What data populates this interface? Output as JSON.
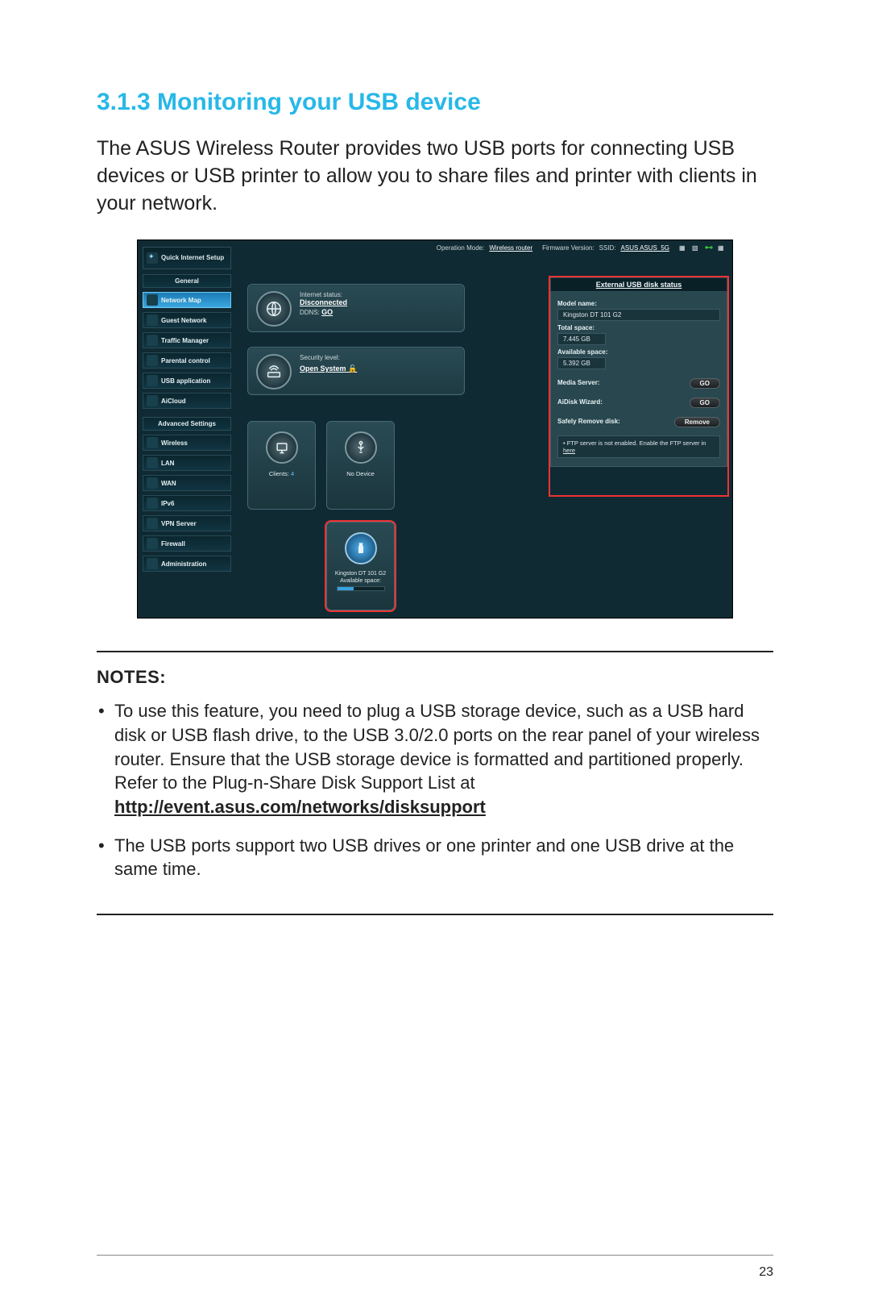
{
  "section": {
    "heading": "3.1.3  Monitoring your USB device",
    "intro": "The ASUS Wireless Router provides two USB ports for connecting USB devices or USB printer to allow you to share files and printer with clients in your network."
  },
  "router": {
    "topbar": {
      "op_mode_label": "Operation Mode:",
      "op_mode_value": "Wireless router",
      "fw_label": "Firmware Version:",
      "ssid_label": "SSID:",
      "ssid_values": "ASUS  ASUS_5G"
    },
    "qis": "Quick Internet Setup",
    "sidebar": {
      "general_heading": "General",
      "items_general": [
        "Network Map",
        "Guest Network",
        "Traffic Manager",
        "Parental control",
        "USB application",
        "AiCloud"
      ],
      "advanced_heading": "Advanced Settings",
      "items_advanced": [
        "Wireless",
        "LAN",
        "WAN",
        "IPv6",
        "VPN Server",
        "Firewall",
        "Administration"
      ]
    },
    "internet_card": {
      "status_label": "Internet status:",
      "status_value": "Disconnected",
      "ddns_label": "DDNS:",
      "ddns_value": "GO"
    },
    "security_card": {
      "level_label": "Security level:",
      "level_value": "Open System"
    },
    "clients_card": {
      "label": "Clients:",
      "count": "4"
    },
    "nodev_card": {
      "label": "No Device"
    },
    "usb_card": {
      "name": "Kingston DT 101 G2",
      "avail_label": "Available space:"
    },
    "right_panel": {
      "title": "External USB disk status",
      "model_label": "Model name:",
      "model_value": "Kingston DT 101 G2",
      "total_label": "Total space:",
      "total_value": "7.445 GB",
      "avail_label": "Available space:",
      "avail_value": "5.392 GB",
      "media_label": "Media Server:",
      "aidisk_label": "AiDisk Wizard:",
      "go_btn": "GO",
      "remove_label": "Safely Remove disk:",
      "remove_btn": "Remove",
      "ftp_note_a": "FTP server is not enabled. Enable the FTP server in ",
      "ftp_note_b": "here"
    }
  },
  "notes": {
    "heading": "NOTES:",
    "item1_a": "To use this feature, you need to plug a USB storage device, such as a USB hard disk or USB flash drive, to the USB 3.0/2.0 ports on the rear panel of your wireless router. Ensure that the USB storage device is formatted and partitioned properly. Refer to the Plug-n-Share Disk Support List at ",
    "item1_b": "http://event.asus.com/networks/disksupport",
    "item2": "The USB ports support two USB drives or one printer and one USB drive at the same time."
  },
  "page_number": "23"
}
